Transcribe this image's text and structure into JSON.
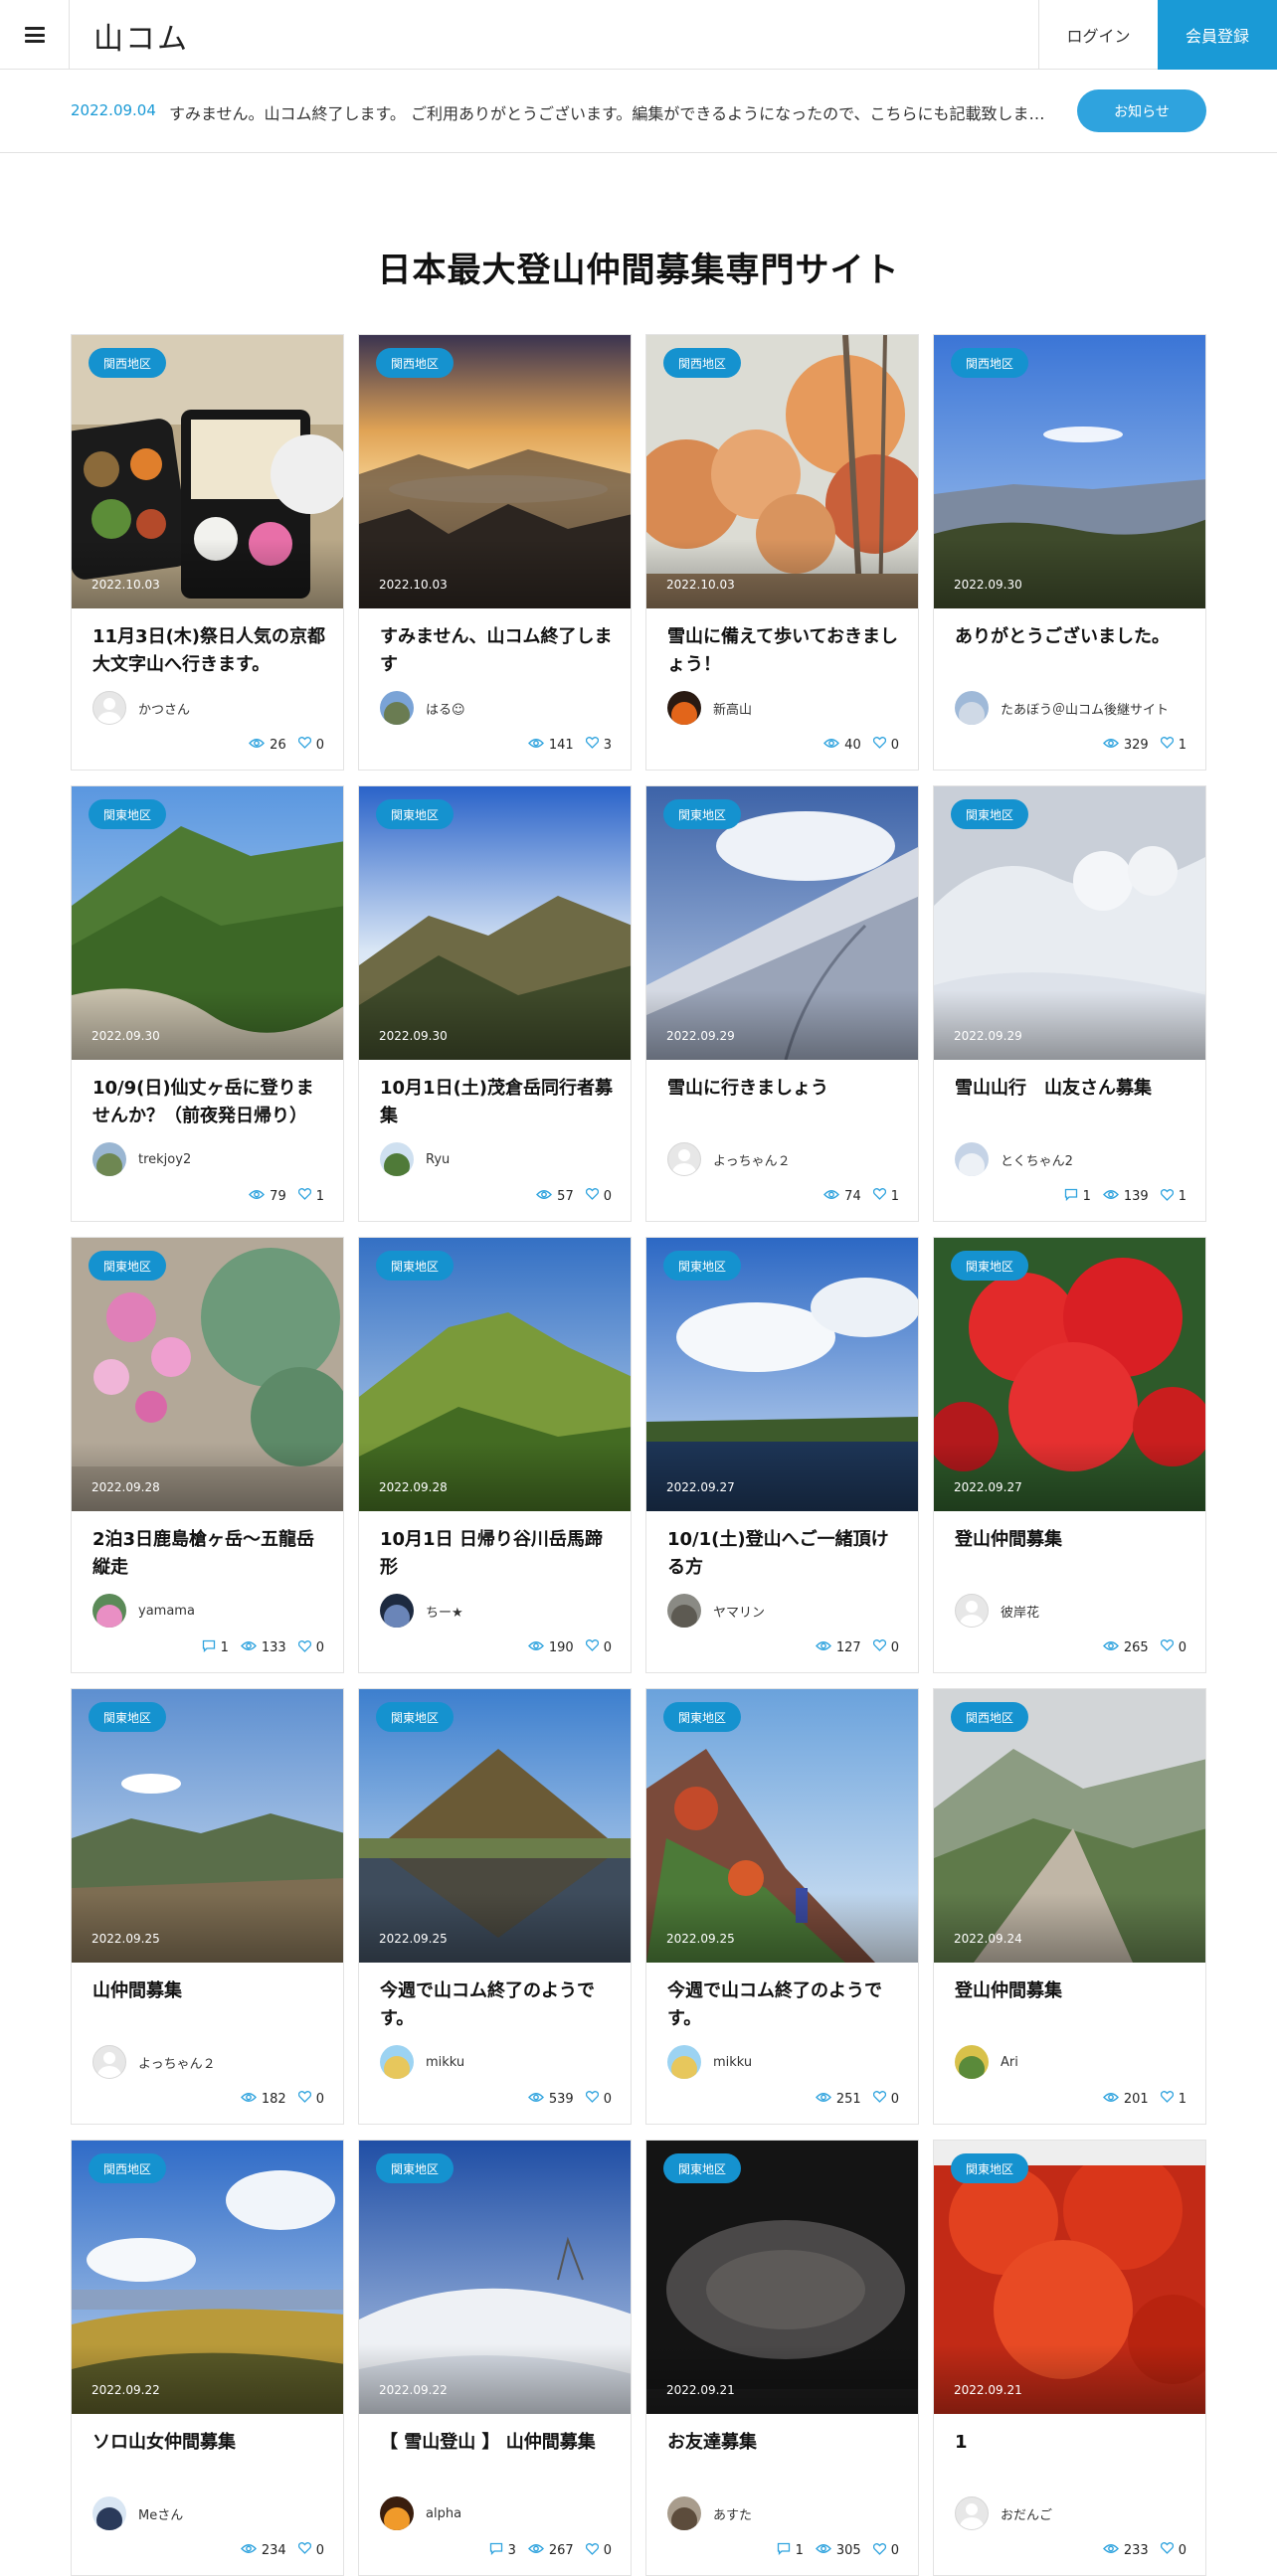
{
  "header": {
    "logo": "山コム",
    "login_label": "ログイン",
    "register_label": "会員登録"
  },
  "notice": {
    "date": "2022.09.04",
    "text": "すみません。山コム終了します。 ご利用ありがとうございます。編集ができるようになったので、こちらにも記載致しま…",
    "button_label": "お知らせ"
  },
  "page_title": "日本最大登山仲間募集専門サイト",
  "colors": {
    "accent": "#1a9ad6",
    "badge": "#1592cf",
    "view_icon": "#2fa3de"
  },
  "cards": [
    {
      "region": "関西地区",
      "date": "2022.10.03",
      "title": "11月3日(木)祭日人気の京都大文字山へ行きます。",
      "author": "かつさん",
      "comments": "",
      "views": "26",
      "likes": "0",
      "image": "bento",
      "avatar": "default"
    },
    {
      "region": "関西地区",
      "date": "2022.10.03",
      "title": "すみません、山コム終了します",
      "author": "はる☺",
      "comments": "",
      "views": "141",
      "likes": "3",
      "image": "sunrise",
      "avatar": "mountain"
    },
    {
      "region": "関西地区",
      "date": "2022.10.03",
      "title": "雪山に備えて歩いておきましょう！",
      "author": "新高山",
      "comments": "",
      "views": "40",
      "likes": "0",
      "image": "autumn",
      "avatar": "fire"
    },
    {
      "region": "関西地区",
      "date": "2022.09.30",
      "title": "ありがとうございました。",
      "author": "たあぼう＠山コム後継サイト",
      "comments": "",
      "views": "329",
      "likes": "1",
      "image": "bluesky",
      "avatar": "sky"
    },
    {
      "region": "関東地区",
      "date": "2022.09.30",
      "title": "10/9(日)仙丈ヶ岳に登りませんか？（前夜発日帰り）",
      "author": "trekjoy2",
      "comments": "",
      "views": "79",
      "likes": "1",
      "image": "greenpeak",
      "avatar": "hill"
    },
    {
      "region": "関東地区",
      "date": "2022.09.30",
      "title": "10月1日(土)茂倉岳同行者募集",
      "author": "Ryu",
      "comments": "",
      "views": "57",
      "likes": "0",
      "image": "ridge",
      "avatar": "green"
    },
    {
      "region": "関東地区",
      "date": "2022.09.29",
      "title": "雪山に行きましょう",
      "author": "よっちゃん２",
      "comments": "",
      "views": "74",
      "likes": "1",
      "image": "snowslope",
      "avatar": "default"
    },
    {
      "region": "関東地区",
      "date": "2022.09.29",
      "title": "雪山山行　山友さん募集",
      "author": "とくちゃん2",
      "comments": "1",
      "views": "139",
      "likes": "1",
      "image": "snowtrees",
      "avatar": "snow"
    },
    {
      "region": "関東地区",
      "date": "2022.09.28",
      "title": "2泊3日鹿島槍ヶ岳〜五龍岳縦走",
      "author": "yamama",
      "comments": "1",
      "views": "133",
      "likes": "0",
      "image": "flowers",
      "avatar": "pink"
    },
    {
      "region": "関東地区",
      "date": "2022.09.28",
      "title": "10月1日 日帰り谷川岳馬蹄形",
      "author": "ちー★",
      "comments": "",
      "views": "190",
      "likes": "0",
      "image": "grassridge",
      "avatar": "dark"
    },
    {
      "region": "関東地区",
      "date": "2022.09.27",
      "title": "10/1(土)登山へご一緒頂ける方",
      "author": "ヤマリン",
      "comments": "",
      "views": "127",
      "likes": "0",
      "image": "lake",
      "avatar": "grey"
    },
    {
      "region": "関東地区",
      "date": "2022.09.27",
      "title": "登山仲間募集",
      "author": "彼岸花",
      "comments": "",
      "views": "265",
      "likes": "0",
      "image": "redflower",
      "avatar": "default"
    },
    {
      "region": "関東地区",
      "date": "2022.09.25",
      "title": "山仲間募集",
      "author": "よっちゃん２",
      "comments": "",
      "views": "182",
      "likes": "0",
      "image": "valley",
      "avatar": "default"
    },
    {
      "region": "関東地区",
      "date": "2022.09.25",
      "title": "今週で山コム終了のようです。",
      "author": "mikku",
      "comments": "",
      "views": "539",
      "likes": "0",
      "image": "lakemountain",
      "avatar": "cartoon"
    },
    {
      "region": "関東地区",
      "date": "2022.09.25",
      "title": "今週で山コム終了のようです。",
      "author": "mikku",
      "comments": "",
      "views": "251",
      "likes": "0",
      "image": "hikers",
      "avatar": "cartoon"
    },
    {
      "region": "関西地区",
      "date": "2022.09.24",
      "title": "登山仲間募集",
      "author": "Ari",
      "comments": "",
      "views": "201",
      "likes": "1",
      "image": "misty",
      "avatar": "yellow"
    },
    {
      "region": "関西地区",
      "date": "2022.09.22",
      "title": "ソロ山女仲間募集",
      "author": "Meさん",
      "comments": "",
      "views": "234",
      "likes": "0",
      "image": "plateau",
      "avatar": "person"
    },
    {
      "region": "関東地区",
      "date": "2022.09.22",
      "title": "【 雪山登山 】 山仲間募集",
      "author": "alpha",
      "comments": "3",
      "views": "267",
      "likes": "0",
      "image": "snowhill",
      "avatar": "sunset"
    },
    {
      "region": "関東地区",
      "date": "2022.09.21",
      "title": "お友達募集",
      "author": "あすた",
      "comments": "1",
      "views": "305",
      "likes": "0",
      "image": "sandwriting",
      "avatar": "brown"
    },
    {
      "region": "関東地区",
      "date": "2022.09.21",
      "title": "1",
      "author": "おだんご",
      "comments": "",
      "views": "233",
      "likes": "0",
      "image": "shavedice",
      "avatar": "default"
    }
  ]
}
